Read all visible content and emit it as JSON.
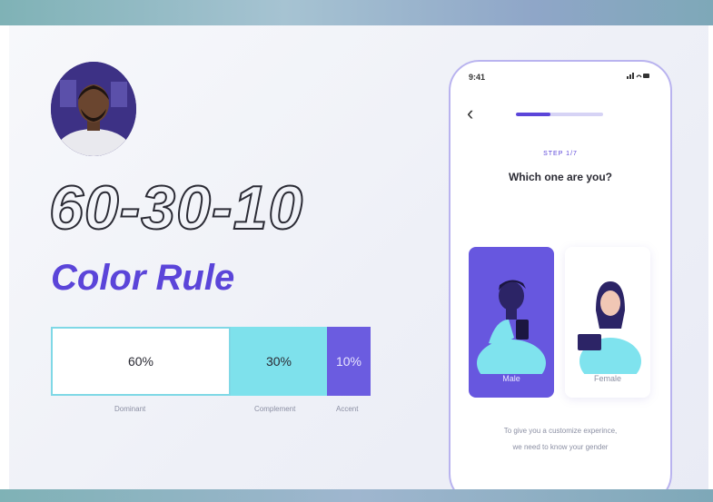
{
  "left": {
    "headline_numbers": "60-30-10",
    "headline_text": "Color Rule",
    "bar": {
      "segments": [
        {
          "label": "60%",
          "value": 60,
          "color": "#ffffff"
        },
        {
          "label": "30%",
          "value": 30,
          "color": "#7ee1ec"
        },
        {
          "label": "10%",
          "value": 10,
          "color": "#6b5ce0"
        }
      ],
      "labels": [
        "Dominant",
        "Complement",
        "Accent"
      ]
    }
  },
  "phone": {
    "status_time": "9:41",
    "status_icons": "signal wifi battery",
    "back_icon": "chevron-left-icon",
    "progress": 0.4,
    "step_label": "STEP 1/7",
    "question": "Which one are you?",
    "options": [
      {
        "label": "Male",
        "selected": true,
        "color": "#6757df"
      },
      {
        "label": "Female",
        "selected": false,
        "color": "#ffffff"
      }
    ],
    "note_line1": "To give you a customize experince,",
    "note_line2": "we need to know your gender"
  },
  "colors": {
    "accent": "#5b45d9",
    "complement": "#7ee1ec",
    "phone_border": "#b9b3ef"
  }
}
